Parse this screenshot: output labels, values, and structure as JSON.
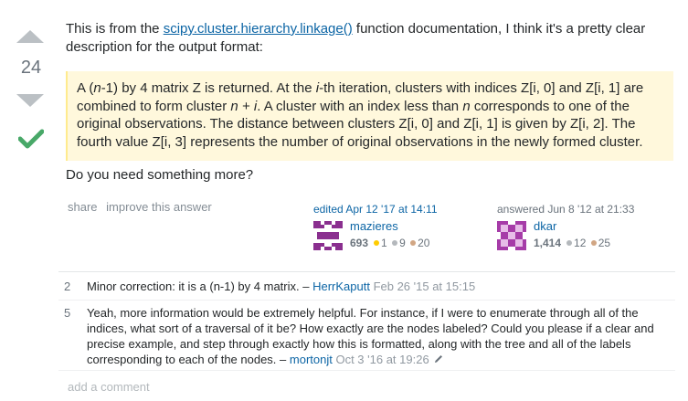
{
  "vote": {
    "count": "24"
  },
  "post": {
    "intro_before": "This is from the ",
    "intro_link": "scipy.cluster.hierarchy.linkage()",
    "intro_after": " function documentation, I think it's a pretty clear description for the output format:",
    "quote": {
      "l1a": "A (",
      "l1b": "n",
      "l1c": "-1) by 4 matrix Z is returned. At the ",
      "l1d": "i",
      "l1e": "-th iteration, clusters with indices Z[i, 0] and Z[i, 1] are",
      "l2a": "combined to form cluster ",
      "l2b": "n + i",
      "l2c": ". A cluster with an index less than ",
      "l2d": "n",
      "l2e": " corresponds to one of the",
      "l3": "original observations. The distance between clusters Z[i, 0] and Z[i, 1] is given by Z[i, 2]. The",
      "l4": "fourth value Z[i, 3] represents the number of original observations in the newly formed cluster."
    },
    "more": "Do you need something more?"
  },
  "menu": {
    "share": "share",
    "improve": "improve this answer"
  },
  "edited": {
    "action": "edited Apr 12 '17 at 14:11",
    "user": "mazieres",
    "rep": "693",
    "gold": "1",
    "silver": "9",
    "bronze": "20"
  },
  "answered": {
    "action": "answered Jun 8 '12 at 21:33",
    "user": "dkar",
    "rep": "1,414",
    "silver": "12",
    "bronze": "25"
  },
  "comments": [
    {
      "score": "2",
      "text": "Minor correction: it is a (n-1) by 4 matrix. – ",
      "user": "HerrKaputt",
      "date": " Feb 26 '15 at 15:15"
    },
    {
      "score": "5",
      "l1": "Yeah, more information would be extremely helpful. For instance, if I were to enumerate through all of the",
      "l2": "indices, what sort of a traversal of it be? How exactly are the nodes labeled? Could you please if a clear and",
      "l3": "precise example, and step through exactly how this is formatted, along with the tree and all of the labels",
      "l4": "corresponding to each of the nodes. – ",
      "user": "mortonjt",
      "date": " Oct 3 '16 at 19:26"
    }
  ],
  "add_comment": "add a comment",
  "colors": {
    "link": "#0c65a5",
    "quote_bg": "#fff8dc",
    "accepted": "#48a868"
  }
}
